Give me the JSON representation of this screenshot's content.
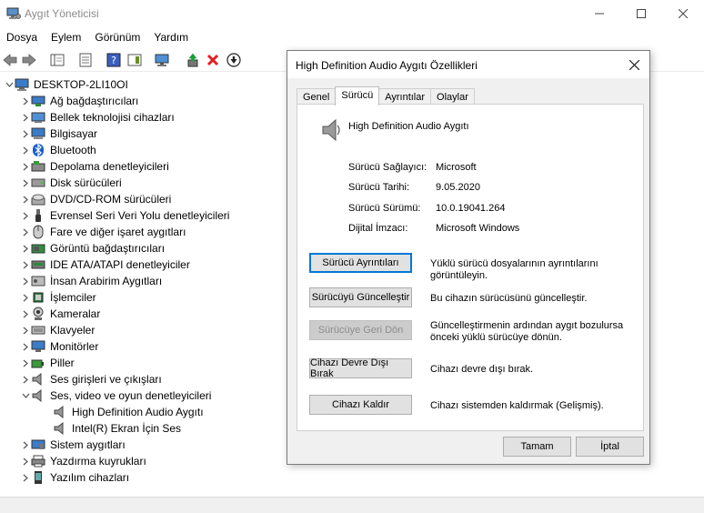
{
  "window": {
    "title": "Aygıt Yöneticisi",
    "minimize": "—",
    "maximize": "☐",
    "close": "✕"
  },
  "menu": [
    "Dosya",
    "Eylem",
    "Görünüm",
    "Yardım"
  ],
  "tree": {
    "root": "DESKTOP-2LI10OI",
    "items": [
      {
        "label": "Ağ bağdaştırıcıları",
        "icon": "network-adapter-icon",
        "expanded": false
      },
      {
        "label": "Bellek teknolojisi cihazları",
        "icon": "memory-tech-icon",
        "expanded": false
      },
      {
        "label": "Bilgisayar",
        "icon": "computer-icon",
        "expanded": false
      },
      {
        "label": "Bluetooth",
        "icon": "bluetooth-icon",
        "expanded": false
      },
      {
        "label": "Depolama denetleyicileri",
        "icon": "storage-controller-icon",
        "expanded": false
      },
      {
        "label": "Disk sürücüleri",
        "icon": "disk-drive-icon",
        "expanded": false
      },
      {
        "label": "DVD/CD-ROM sürücüleri",
        "icon": "dvd-icon",
        "expanded": false
      },
      {
        "label": "Evrensel Seri Veri Yolu denetleyicileri",
        "icon": "usb-icon",
        "expanded": false
      },
      {
        "label": "Fare ve diğer işaret aygıtları",
        "icon": "mouse-icon",
        "expanded": false
      },
      {
        "label": "Görüntü bağdaştırıcıları",
        "icon": "display-adapter-icon",
        "expanded": false
      },
      {
        "label": "IDE ATA/ATAPI denetleyiciler",
        "icon": "ide-icon",
        "expanded": false
      },
      {
        "label": "İnsan Arabirim Aygıtları",
        "icon": "hid-icon",
        "expanded": false
      },
      {
        "label": "İşlemciler",
        "icon": "processor-icon",
        "expanded": false
      },
      {
        "label": "Kameralar",
        "icon": "camera-icon",
        "expanded": false
      },
      {
        "label": "Klavyeler",
        "icon": "keyboard-icon",
        "expanded": false
      },
      {
        "label": "Monitörler",
        "icon": "monitor-icon",
        "expanded": false
      },
      {
        "label": "Piller",
        "icon": "battery-icon",
        "expanded": false
      },
      {
        "label": "Ses girişleri ve çıkışları",
        "icon": "audio-io-icon",
        "expanded": false
      },
      {
        "label": "Ses, video ve oyun denetleyicileri",
        "icon": "sound-icon",
        "expanded": true
      },
      {
        "label": "High Definition Audio Aygıtı",
        "icon": "speaker-icon",
        "child": true
      },
      {
        "label": "Intel(R) Ekran İçin Ses",
        "icon": "speaker-icon",
        "child": true
      },
      {
        "label": "Sistem aygıtları",
        "icon": "system-devices-icon",
        "expanded": false
      },
      {
        "label": "Yazdırma kuyrukları",
        "icon": "printer-icon",
        "expanded": false
      },
      {
        "label": "Yazılım cihazları",
        "icon": "software-device-icon",
        "expanded": false
      }
    ]
  },
  "dialog": {
    "title": "High Definition Audio Aygıtı Özellikleri",
    "tabs": [
      "Genel",
      "Sürücü",
      "Ayrıntılar",
      "Olaylar"
    ],
    "active_tab": "Sürücü",
    "device_name": "High Definition Audio Aygıtı",
    "properties": [
      {
        "label": "Sürücü Sağlayıcı:",
        "value": "Microsoft"
      },
      {
        "label": "Sürücü Tarihi:",
        "value": "9.05.2020"
      },
      {
        "label": "Sürücü Sürümü:",
        "value": "10.0.19041.264"
      },
      {
        "label": "Dijital İmzacı:",
        "value": "Microsoft Windows"
      }
    ],
    "actions": [
      {
        "button": "Sürücü Ayrıntıları",
        "desc": "Yüklü sürücü dosyalarının ayrıntılarını görüntüleyin.",
        "disabled": false,
        "focused": true
      },
      {
        "button": "Sürücüyü Güncelleştir",
        "desc": "Bu cihazın sürücüsünü güncelleştir.",
        "disabled": false,
        "focused": false
      },
      {
        "button": "Sürücüye Geri Dön",
        "desc": "Güncelleştirmenin ardından aygıt bozulursa önceki yüklü sürücüye dönün.",
        "disabled": true,
        "focused": false
      },
      {
        "button": "Cihazı Devre Dışı Bırak",
        "desc": "Cihazı devre dışı bırak.",
        "disabled": false,
        "focused": false
      },
      {
        "button": "Cihazı Kaldır",
        "desc": "Cihazı sistemden kaldırmak (Gelişmiş).",
        "disabled": false,
        "focused": false
      }
    ],
    "ok": "Tamam",
    "cancel": "İptal"
  },
  "colors": {
    "accent": "#0078d7",
    "disabled_button": "#cccccc",
    "dialog_bg": "#f0f0f0"
  }
}
